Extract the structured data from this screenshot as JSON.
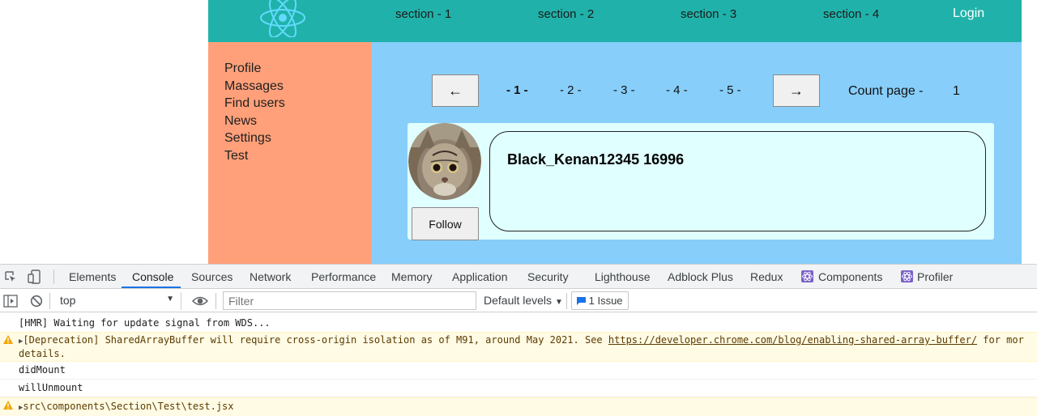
{
  "header": {
    "nav": [
      "section - 1",
      "section - 2",
      "section - 3",
      "section - 4"
    ],
    "login": "Login",
    "color": "#20b2aa"
  },
  "sidebar": {
    "items": [
      "Profile",
      "Massages",
      "Find users",
      "News",
      "Settings",
      "Test"
    ],
    "color": "#ffa07a"
  },
  "pagination": {
    "prev": "←",
    "next": "→",
    "pages": [
      "- 1 -",
      "- 2 -",
      "- 3 -",
      "- 4 -",
      "- 5 -"
    ],
    "active_page": 1,
    "count_label": "Count page -",
    "count_value": "1"
  },
  "user": {
    "name": "Black_Kenan12345 16996",
    "follow_label": "Follow"
  },
  "devtools": {
    "tabs": [
      "Elements",
      "Console",
      "Sources",
      "Network",
      "Performance",
      "Memory",
      "Application",
      "Security",
      "Lighthouse",
      "Adblock Plus",
      "Redux",
      "Components",
      "Profiler"
    ],
    "active_tab": "Console",
    "context": "top",
    "filter_placeholder": "Filter",
    "levels": "Default levels",
    "issues": "1 Issue",
    "messages": [
      {
        "type": "log",
        "text": "[HMR] Waiting for update signal from WDS..."
      },
      {
        "type": "warn",
        "text": "[Deprecation] SharedArrayBuffer will require cross-origin isolation as of M91, around May 2021. See ",
        "link": "https://developer.chrome.com/blog/enabling-shared-array-buffer/",
        "tail": " for mor",
        "line2": "details."
      },
      {
        "type": "log",
        "text": "didMount"
      },
      {
        "type": "log",
        "text": "willUnmount"
      },
      {
        "type": "warn",
        "text": "src\\components\\Section\\Test\\test.jsx"
      }
    ]
  }
}
